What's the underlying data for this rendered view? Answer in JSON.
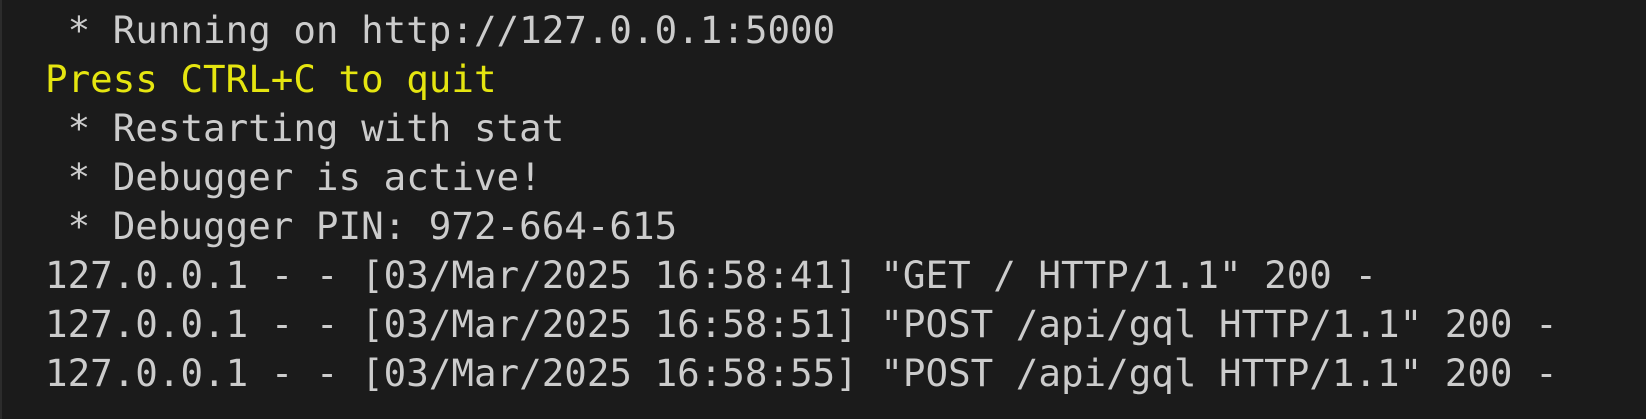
{
  "terminal": {
    "colors": {
      "background": "#1b1b1b",
      "text": "#cccccc",
      "warning": "#e5e510"
    },
    "lines": [
      {
        "text": " * Running on http://127.0.0.1:5000",
        "style": "normal"
      },
      {
        "text": "Press CTRL+C to quit",
        "style": "warning"
      },
      {
        "text": " * Restarting with stat",
        "style": "normal"
      },
      {
        "text": " * Debugger is active!",
        "style": "normal"
      },
      {
        "text": " * Debugger PIN: 972-664-615",
        "style": "normal"
      },
      {
        "text": "127.0.0.1 - - [03/Mar/2025 16:58:41] \"GET / HTTP/1.1\" 200 -",
        "style": "normal"
      },
      {
        "text": "127.0.0.1 - - [03/Mar/2025 16:58:51] \"POST /api/gql HTTP/1.1\" 200 -",
        "style": "normal"
      },
      {
        "text": "127.0.0.1 - - [03/Mar/2025 16:58:55] \"POST /api/gql HTTP/1.1\" 200 -",
        "style": "normal"
      }
    ]
  }
}
